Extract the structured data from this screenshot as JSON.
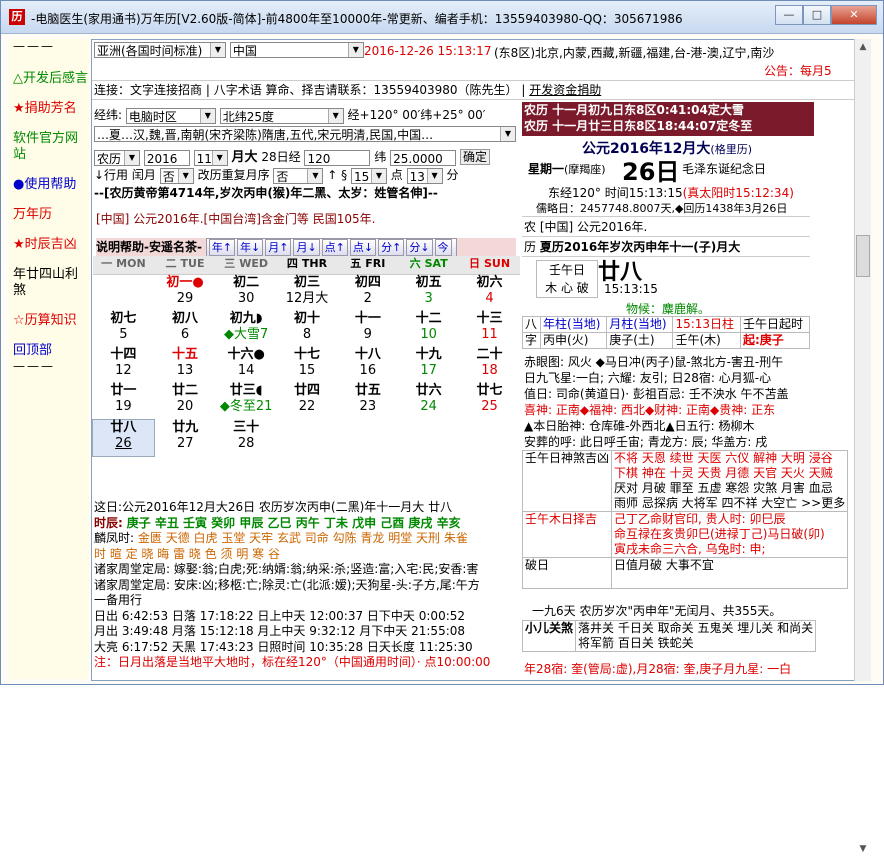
{
  "title": "-电脑医生(家用通书)万年历[V2.60版-简体]-前4800年至10000年-常更新、编者手机：13559403980-QQ：305671986",
  "window_buttons": {
    "min": "—",
    "max": "□",
    "close": "✕"
  },
  "leftnav": {
    "sep": "———",
    "items": [
      {
        "icon": "△",
        "label": "开发后感言",
        "color": "#080"
      },
      {
        "icon": "★",
        "label": "捐助芳名",
        "color": "#d00"
      },
      {
        "icon": "",
        "label": "软件官方网站",
        "color": "#080"
      },
      {
        "icon": "●",
        "label": "使用帮助",
        "color": "#00c"
      },
      {
        "icon": "",
        "label": "万年历",
        "color": "#d00"
      },
      {
        "icon": "★",
        "label": "时辰吉凶",
        "color": "#d00"
      },
      {
        "icon": "",
        "label": "年廿四山利煞",
        "color": "#000"
      },
      {
        "icon": "☆",
        "label": "历算知识",
        "color": "#d00"
      },
      {
        "icon": "",
        "label": "回顶部",
        "color": "#00c"
      }
    ]
  },
  "toolbar": {
    "region": "亚洲(各国时间标准)",
    "country": "中国",
    "datetime": "2016-12-26  15:13:17",
    "zone_info": "(东8区)北京,内蒙,西藏,新疆,福建,台-港-澳,辽宁,南沙",
    "notice": "公告：每月5"
  },
  "contact": {
    "prefix": "连接：",
    "link1": "文字连接招商",
    "link2": "八字术语",
    "middle": "算命、择吉请联系：13559403980（陈先生）",
    "link3": "开发资金捐助"
  },
  "location": {
    "lon_label": "经纬:",
    "lon_select": "电脑时区",
    "lat_select": "北纬25度",
    "lonlat_text": "经+120° 00′纬+25° 00′",
    "dynasty": "…夏…汉,魏,晋,南朝(宋齐梁陈)隋唐,五代,宋元明清,民国,中国…"
  },
  "dateinput": {
    "cal_type": "农历",
    "year": "2016",
    "month": "11",
    "size": "月大",
    "day_label": "28日经",
    "lon": "120",
    "lat_label": "纬",
    "lat": "25.0000",
    "confirm": "确定",
    "leap_label": "闰月",
    "leap": "否",
    "ignore_label": "改历重复月序",
    "ignore": "否",
    "hour": "15",
    "hour_label": "点",
    "minute": "13",
    "minute_label": "分",
    "start_label": "↑",
    "sec_label": "§",
    "ordering": "↓行用"
  },
  "yearline": "--[农历黄帝第4714年,岁次丙申(猴)年二黑、太岁：姓管名伸]--",
  "era_line": "[中国] 公元2016年.[中国台湾]含金门等 民国105年.",
  "helpbar": {
    "label": "说明帮助-安遥名茶-",
    "buttons": [
      "年↑",
      "年↓",
      "月↑",
      "月↓",
      "点↑",
      "点↓",
      "分↑",
      "分↓",
      "今"
    ]
  },
  "weekdays": [
    {
      "cn": "一",
      "en": "MON",
      "color": "#666"
    },
    {
      "cn": "二",
      "en": "TUE",
      "color": "#666"
    },
    {
      "cn": "三",
      "en": "WED",
      "color": "#666"
    },
    {
      "cn": "四",
      "en": "THR",
      "color": "#000"
    },
    {
      "cn": "五",
      "en": "FRI",
      "color": "#000"
    },
    {
      "cn": "六",
      "en": "SAT",
      "color": "#080"
    },
    {
      "cn": "日",
      "en": "SUN",
      "color": "#d00"
    }
  ],
  "calendar": [
    [
      {
        "top": "",
        "num": ""
      },
      {
        "top": "初一●",
        "num": "29",
        "tc": "#d00"
      },
      {
        "top": "初二",
        "num": "30"
      },
      {
        "top": "初三",
        "num": "12月大"
      },
      {
        "top": "初四",
        "num": "2"
      },
      {
        "top": "初五",
        "num": "3",
        "nc": "#080"
      },
      {
        "top": "初六",
        "num": "4",
        "nc": "#d00"
      }
    ],
    [
      {
        "top": "初七",
        "num": "5"
      },
      {
        "top": "初八",
        "num": "6"
      },
      {
        "top": "初九◗",
        "num": "◆大雪7",
        "nc": "#080"
      },
      {
        "top": "初十",
        "num": "8"
      },
      {
        "top": "十一",
        "num": "9"
      },
      {
        "top": "十二",
        "num": "10",
        "nc": "#080"
      },
      {
        "top": "十三",
        "num": "11",
        "nc": "#d00"
      }
    ],
    [
      {
        "top": "十四",
        "num": "12"
      },
      {
        "top": "十五",
        "num": "13",
        "tc": "#d00"
      },
      {
        "top": "十六●",
        "num": "14"
      },
      {
        "top": "十七",
        "num": "15"
      },
      {
        "top": "十八",
        "num": "16"
      },
      {
        "top": "十九",
        "num": "17",
        "nc": "#080"
      },
      {
        "top": "二十",
        "num": "18",
        "nc": "#d00"
      }
    ],
    [
      {
        "top": "廿一",
        "num": "19"
      },
      {
        "top": "廿二",
        "num": "20"
      },
      {
        "top": "廿三◖",
        "num": "◆冬至21",
        "nc": "#080"
      },
      {
        "top": "廿四",
        "num": "22"
      },
      {
        "top": "廿五",
        "num": "23"
      },
      {
        "top": "廿六",
        "num": "24",
        "nc": "#080"
      },
      {
        "top": "廿七",
        "num": "25",
        "nc": "#d00"
      }
    ],
    [
      {
        "top": "廿八",
        "num": "26",
        "today": true
      },
      {
        "top": "廿九",
        "num": "27"
      },
      {
        "top": "三十",
        "num": "28"
      },
      {
        "top": "",
        "num": ""
      },
      {
        "top": "",
        "num": ""
      },
      {
        "top": "",
        "num": ""
      },
      {
        "top": "",
        "num": ""
      }
    ]
  ],
  "dayinfo": {
    "line1": "这日:公元2016年12月大26日  农历岁次丙申(二黑)年十一月大  廿八",
    "line2_label": "时辰:",
    "line2": "庚子 辛丑 壬寅 癸卯 甲辰 乙巳 丙午 丁未 戊申 己酉 庚戌 辛亥",
    "line3_label": "麟凤时:",
    "line3": "金匮 天德 白虎 玉堂 天牢 玄武 司命 勾陈 青龙 明堂 天刑 朱雀",
    "line4": "时  暄  定  晓  晦  雷  晓  色  须  明  寒  谷",
    "line5": "诸家周堂定局: 嫁娶:翁;白虎;死:纳婿:翁;纳采:杀;竖造:富;入宅:民;安香:害",
    "line6": "诸家周堂定局: 安床:凶;移柩:亡;除灵:亡(北派:嫒);天狗星-头:子方,尾:午方",
    "line7": "一备用行",
    "line8": "日出 6:42:53 日落 17:18:22 日上中天 12:00:37 日下中天 0:00:52",
    "line9": "月出 3:49:48 月落 15:12:18 月上中天 9:32:12 月下中天 21:55:08",
    "line10": "大亮 6:17:52 天黑 17:43:23 日照时间 10:35:28 日天长度 11:25:30",
    "line11": "注：日月出落是当地平大地时，标在经120°（中国通用时间）· 点10:00:00"
  },
  "right": {
    "jieqi1": "农历 十一月初九日东8区0:41:04定大雪",
    "jieqi2": "农历 十一月廿三日东8区18:44:07定冬至",
    "gregorian": "公元2016年12月大",
    "greg_note": "(格里历)",
    "weekday": "星期一",
    "weekday_note": "(摩羯座)",
    "day": "26日",
    "memorial": "毛泽东诞纪念日",
    "east": "东经120° 时间15:13:15",
    "solar": "(真太阳时15:12:34)",
    "julian": "儒略日：2457748.8007天,◆回历1438年3月26日",
    "nong_label": "农",
    "nong_text": "[中国] 公元2016年.",
    "li_label": "历",
    "li_text": "夏历2016年岁次丙申年十一(子)月大",
    "box1": "壬午日",
    "box2": "木 心 破",
    "big_day": "廿八",
    "time": "15:13:15",
    "wuhou": "物候：麋鹿解。",
    "bazi_head": [
      "八",
      "年柱(当地)",
      "月柱(当地)",
      "15:13日柱",
      "壬午日起时"
    ],
    "bazi_row": [
      "字",
      "丙申(火)",
      "庚子(土)",
      "壬午(木)",
      "起:庚子"
    ],
    "chixing": "赤眼图: 风火 ◆马日冲(丙子)鼠-煞北方-害丑-刑午",
    "jiuxing": "日九飞星:一白; 六耀: 友引; 日28宿: 心月狐-心",
    "zhiri": "值日: 司命(黄道日)· 彭祖百忌: 壬不泱水 午不苫盖",
    "xishen": "喜神: 正南◆福神: 西北◆财神: 正南◆贵神: 正东",
    "taishen": "▲本日胎神: 仓库碓-外西北▲日五行: 杨柳木",
    "anjia": "安葬的呼: 此日呼壬宙; 青龙方: 辰; 华盖方: 戌",
    "rishen_label": "壬午日神煞吉凶",
    "rishen1": "不将 天恩 续世 天医 六仪 解神 大明 浸谷",
    "rishen2": "下棋 神在 十灵 天贵 月德 天官 天火 天贼",
    "rishen3": "厌对 月破 罪至 五虚 寒怨 灾煞 月害 血忌",
    "rishen4": "雨师 忌探病 大将军 四不祥 大空亡 >>更多",
    "zeji_label": "壬午木日择吉",
    "zeji1": "己丁乙命财官印, 贵人时: 卯巳辰",
    "zeji2": "命互禄在亥贵卯巳(进禄丁己)马日破(卯)",
    "zeji3": "寅戌未命三六合, 乌兔时: 申;",
    "pori_label": "破日",
    "pori": "日值月破  大事不宜",
    "jiuliu": "一九6天  农历岁次\"丙申年\"无闰月、共355天。",
    "xiaoer_label": "小儿关煞",
    "xiaoer1": "落井关 千日关 取命关 五鬼关 埋儿关 和尚关",
    "xiaoer2": "将军箭 百日关 铁蛇关",
    "bottom": "年28宿: 奎(管局:虚),月28宿: 奎,庚子月九星: 一白"
  }
}
